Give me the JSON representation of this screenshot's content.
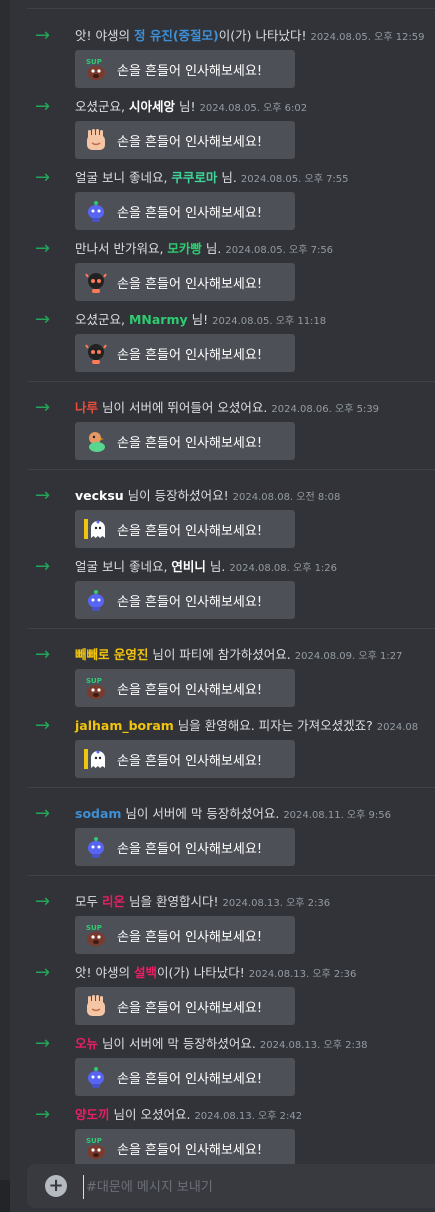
{
  "wave_label": "손을 흔들어 인사해보세요!",
  "composer": {
    "placeholder": "#대문에 메시지 보내기"
  },
  "groups": [
    [
      {
        "pre": "앗! 야생의 ",
        "name": "정 유진(중절모)",
        "name_color": "#3e8fd6",
        "post": "이(가) 나타났다!",
        "ts": "2024.08.05. 오후 12:59",
        "sticker": "dog-icon"
      },
      {
        "pre": "오셨군요, ",
        "name": "시아세앙",
        "name_color": "#ffffff",
        "post": " 님!",
        "ts": "2024.08.05. 오후 6:02",
        "sticker": "hand-icon"
      },
      {
        "pre": "얼굴 보니 좋네요, ",
        "name": "쿠쿠로마",
        "name_color": "#3ed598",
        "post": " 님.",
        "ts": "2024.08.05. 오후 7:55",
        "sticker": "wumpus-icon"
      },
      {
        "pre": "만나서 반가워요, ",
        "name": "모카빵",
        "name_color": "#2ecc71",
        "post": " 님.",
        "ts": "2024.08.05. 오후 7:56",
        "sticker": "robot-icon"
      },
      {
        "pre": "오셨군요, ",
        "name": "MNarmy",
        "name_color": "#2ecc71",
        "post": " 님!",
        "ts": "2024.08.05. 오후 11:18",
        "sticker": "robot-icon"
      }
    ],
    [
      {
        "pre": "",
        "name": "나루",
        "name_color": "#e74c3c",
        "post": " 님이 서버에 뛰어들어 오셨어요.",
        "ts": "2024.08.06. 오후 5:39",
        "sticker": "duck-icon"
      }
    ],
    [
      {
        "pre": "",
        "name": "vecksu",
        "name_color": "#ffffff",
        "post": " 님이 등장하셨어요!",
        "ts": "2024.08.08. 오전 8:08",
        "sticker": "ghost-icon"
      },
      {
        "pre": "얼굴 보니 좋네요, ",
        "name": "연비니",
        "name_color": "#ffffff",
        "post": " 님.",
        "ts": "2024.08.08. 오후 1:26",
        "sticker": "wumpus-icon"
      }
    ],
    [
      {
        "pre": "",
        "name": "빼빼로 운영진",
        "name_color": "#f1c40f",
        "post": " 님이 파티에 참가하셨어요.",
        "ts": "2024.08.09. 오후 1:27",
        "sticker": "dog-icon"
      },
      {
        "pre": "",
        "name": "jalham_boram",
        "name_color": "#f1c40f",
        "post": " 님을 환영해요. 피자는 가져오셨겠죠?",
        "ts": "2024.08",
        "sticker": "ghost-icon"
      }
    ],
    [
      {
        "pre": "",
        "name": "sodam",
        "name_color": "#3e8fd6",
        "post": " 님이 서버에 막 등장하셨어요.",
        "ts": "2024.08.11. 오후 9:56",
        "sticker": "wumpus-icon"
      }
    ],
    [
      {
        "pre": "모두 ",
        "name": "리온",
        "name_color": "#e91e63",
        "post": " 님을 환영합시다!",
        "ts": "2024.08.13. 오후 2:36",
        "sticker": "dog-icon"
      },
      {
        "pre": "앗! 야생의 ",
        "name": "설백",
        "name_color": "#e91e63",
        "post": "이(가) 나타났다!",
        "ts": "2024.08.13. 오후 2:36",
        "sticker": "hand-icon"
      },
      {
        "pre": "",
        "name": "오뉴",
        "name_color": "#e91e63",
        "post": " 님이 서버에 막 등장하셨어요.",
        "ts": "2024.08.13. 오후 2:38",
        "sticker": "wumpus-icon"
      },
      {
        "pre": "",
        "name": "양도끼",
        "name_color": "#e91e63",
        "post": " 님이 오셨어요.",
        "ts": "2024.08.13. 오후 2:42",
        "sticker": "dog-icon"
      }
    ]
  ]
}
